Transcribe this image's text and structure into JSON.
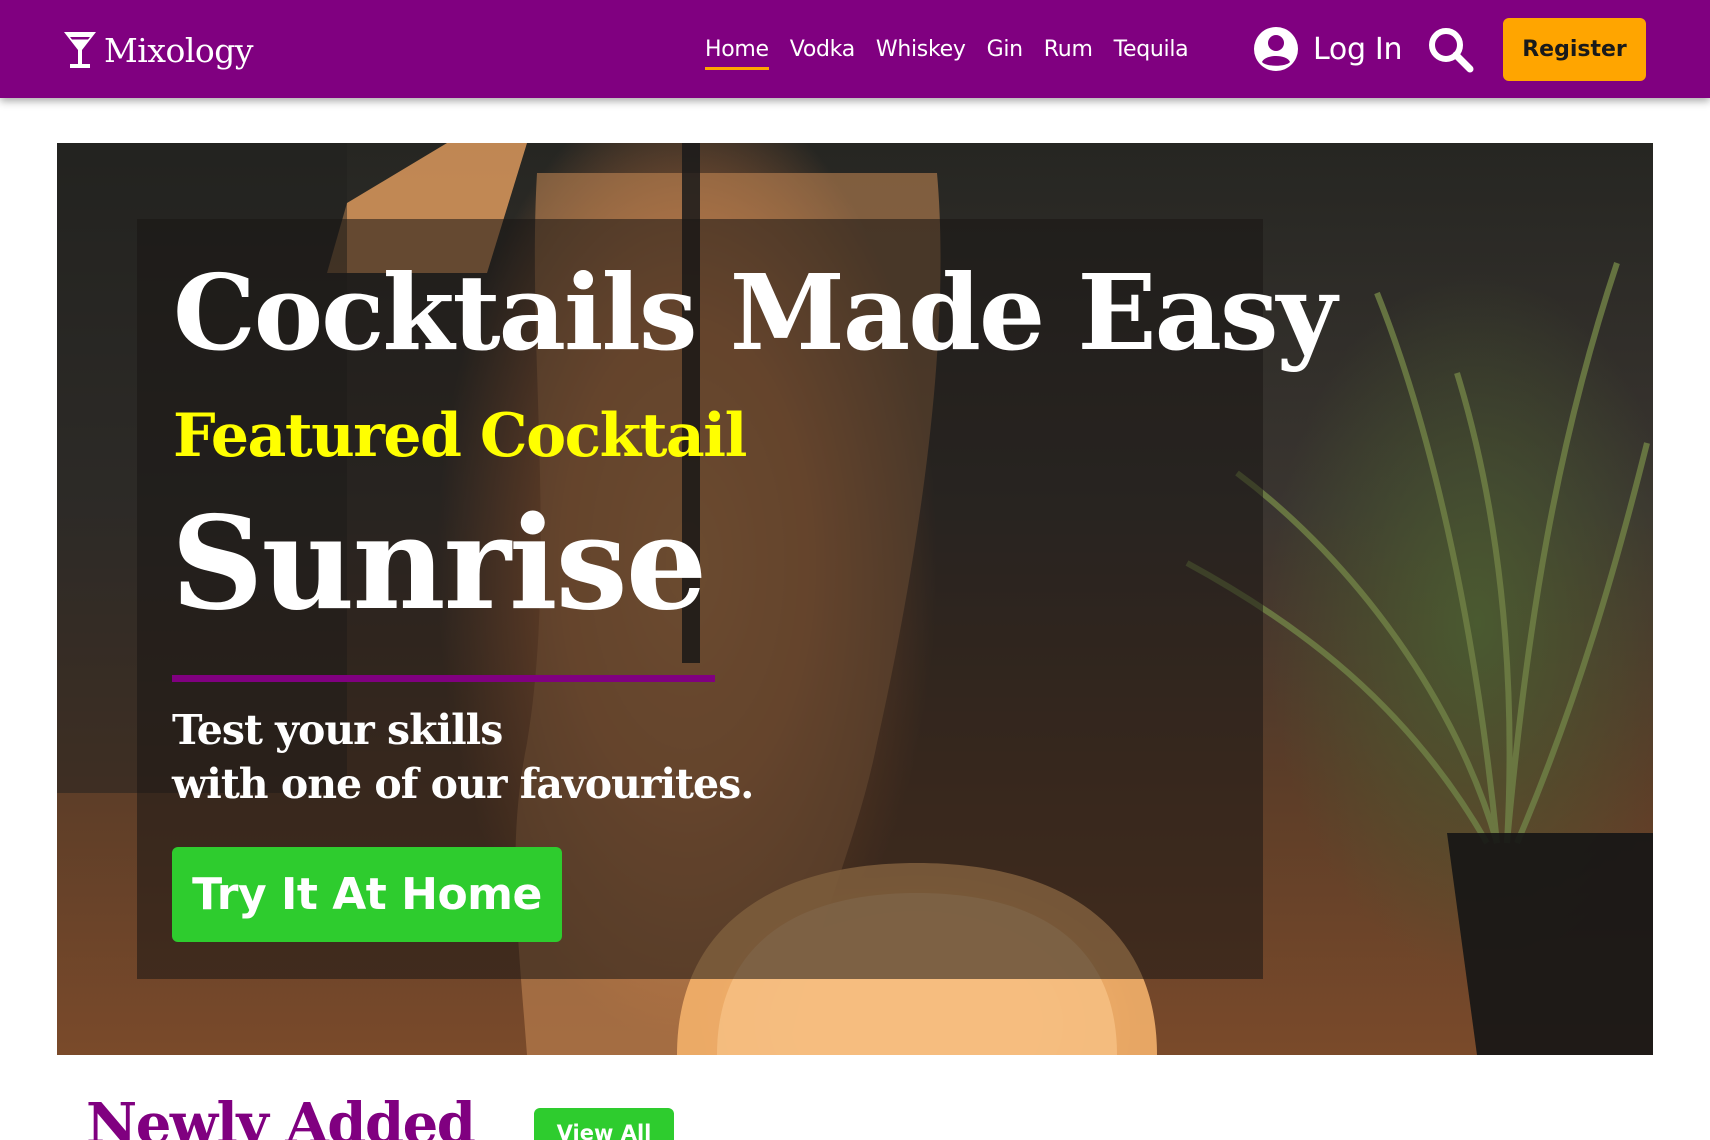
{
  "navbar": {
    "brand": "Mixology",
    "brand_icon": "cocktail-glass-icon",
    "links": [
      {
        "label": "Home",
        "active": true
      },
      {
        "label": "Vodka",
        "active": false
      },
      {
        "label": "Whiskey",
        "active": false
      },
      {
        "label": "Gin",
        "active": false
      },
      {
        "label": "Rum",
        "active": false
      },
      {
        "label": "Tequila",
        "active": false
      }
    ],
    "login_label": "Log In",
    "login_icon": "user-circle-icon",
    "search_icon": "search-icon",
    "register_label": "Register"
  },
  "hero": {
    "title": "Cocktails Made Easy",
    "featured_label": "Featured Cocktail",
    "cocktail_name": "Sunrise",
    "tagline_line1": "Test your skills",
    "tagline_line2": "with one of our favourites.",
    "cta_label": "Try It At Home"
  },
  "newly_added": {
    "title": "Newly Added",
    "view_all_label": "View All"
  },
  "colors": {
    "brand_purple": "#800080",
    "accent_orange": "#ffa500",
    "featured_yellow": "#ffff00",
    "cta_green": "#2ecc2e"
  }
}
